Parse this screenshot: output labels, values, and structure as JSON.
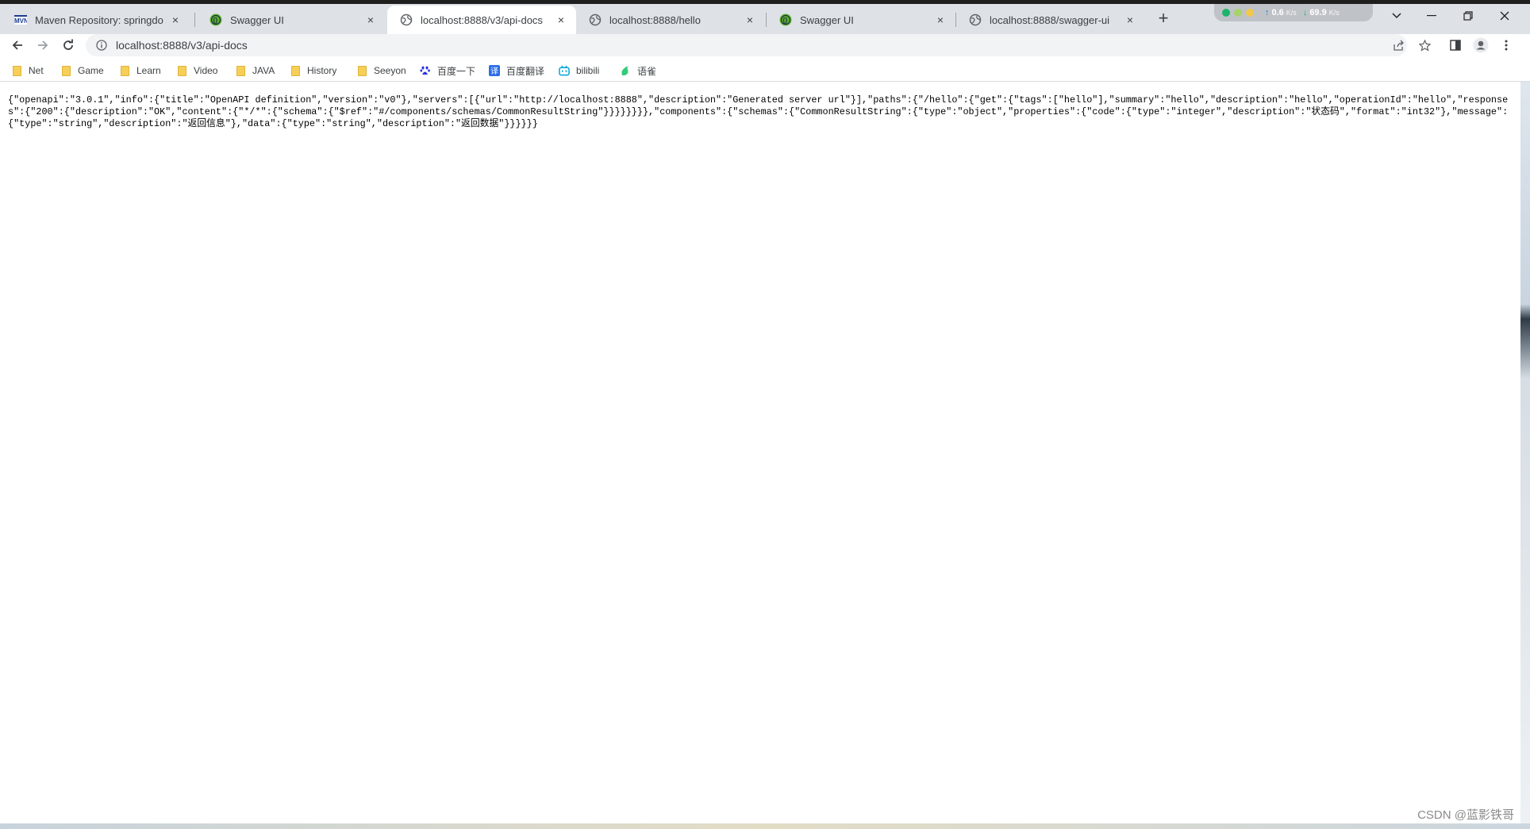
{
  "tabs": [
    {
      "title": "Maven Repository: springdoc-",
      "icon": "mvn-icon"
    },
    {
      "title": "Swagger UI",
      "icon": "swagger-icon"
    },
    {
      "title": "localhost:8888/v3/api-docs",
      "icon": "globe-icon",
      "active": true
    },
    {
      "title": "localhost:8888/hello",
      "icon": "globe-icon"
    },
    {
      "title": "Swagger UI",
      "icon": "swagger-icon"
    },
    {
      "title": "localhost:8888/swagger-ui",
      "icon": "globe-icon"
    }
  ],
  "tab_close_glyph": "×",
  "new_tab_glyph": "+",
  "net_widget": {
    "upload": "0.6",
    "upload_unit": "K/s",
    "download": "69.9",
    "download_unit": "K/s"
  },
  "window_controls": {
    "dropdown": "⌄",
    "minimize": "—",
    "restore": "❐",
    "close": "✕"
  },
  "address_bar": {
    "url": "localhost:8888/v3/api-docs"
  },
  "bookmarks": [
    {
      "label": "Net",
      "icon": "folder-icon"
    },
    {
      "label": "Game",
      "icon": "folder-icon"
    },
    {
      "label": "Learn",
      "icon": "folder-icon"
    },
    {
      "label": "Video",
      "icon": "folder-icon"
    },
    {
      "label": "JAVA",
      "icon": "folder-icon"
    },
    {
      "label": "History",
      "icon": "folder-icon"
    },
    {
      "label": "Seeyon",
      "icon": "folder-icon"
    },
    {
      "label": "百度一下",
      "icon": "baidu-paw-icon"
    },
    {
      "label": "百度翻译",
      "icon": "baidu-translate-icon"
    },
    {
      "label": "bilibili",
      "icon": "bilibili-icon"
    },
    {
      "label": "语雀",
      "icon": "yuque-icon"
    }
  ],
  "page_content": "{\"openapi\":\"3.0.1\",\"info\":{\"title\":\"OpenAPI definition\",\"version\":\"v0\"},\"servers\":[{\"url\":\"http://localhost:8888\",\"description\":\"Generated server url\"}],\"paths\":{\"/hello\":{\"get\":{\"tags\":[\"hello\"],\"summary\":\"hello\",\"description\":\"hello\",\"operationId\":\"hello\",\"responses\":{\"200\":{\"description\":\"OK\",\"content\":{\"*/*\":{\"schema\":{\"$ref\":\"#/components/schemas/CommonResultString\"}}}}}}}},\"components\":{\"schemas\":{\"CommonResultString\":{\"type\":\"object\",\"properties\":{\"code\":{\"type\":\"integer\",\"description\":\"状态码\",\"format\":\"int32\"},\"message\":{\"type\":\"string\",\"description\":\"返回信息\"},\"data\":{\"type\":\"string\",\"description\":\"返回数据\"}}}}}}",
  "watermark": "CSDN @蓝影铁哥",
  "colors": {
    "tabstrip": "#dee1e6",
    "active_tab": "#ffffff",
    "omnibox": "#f1f3f4",
    "folder": "#f6cf57"
  }
}
